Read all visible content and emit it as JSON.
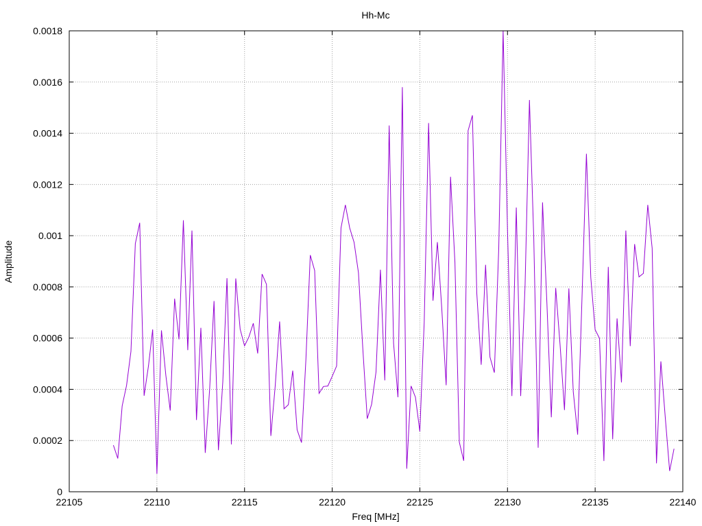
{
  "chart_data": {
    "type": "line",
    "title": "Hh-Mc",
    "xlabel": "Freq [MHz]",
    "ylabel": "Amplitude",
    "xlim": [
      22105,
      22140
    ],
    "ylim": [
      0,
      0.0018
    ],
    "grid": true,
    "x_ticks": [
      22105,
      22110,
      22115,
      22120,
      22125,
      22130,
      22135,
      22140
    ],
    "y_ticks": [
      0,
      0.0002,
      0.0004,
      0.0006,
      0.0008,
      0.001,
      0.0012,
      0.0014,
      0.0016,
      0.0018
    ],
    "x_tick_labels": [
      "22105",
      "22110",
      "22115",
      "22120",
      "22125",
      "22130",
      "22135",
      "22140"
    ],
    "y_tick_labels": [
      "0",
      "0.0002",
      "0.0004",
      "0.0006",
      "0.0008",
      "0.001",
      "0.0012",
      "0.0014",
      "0.0016",
      "0.0018"
    ],
    "series": [
      {
        "color": "#9400d3",
        "x": [
          22107.52,
          22107.77,
          22108.02,
          22108.27,
          22108.52,
          22108.77,
          22109.02,
          22109.27,
          22109.52,
          22109.76,
          22110.0,
          22110.26,
          22110.51,
          22110.76,
          22111.01,
          22111.26,
          22111.51,
          22111.76,
          22112.0,
          22112.26,
          22112.51,
          22112.76,
          22113.01,
          22113.26,
          22113.51,
          22113.76,
          22114.0,
          22114.25,
          22114.5,
          22114.75,
          22115.0,
          22115.25,
          22115.5,
          22115.75,
          22116.0,
          22116.25,
          22116.5,
          22116.75,
          22117.0,
          22117.25,
          22117.5,
          22117.75,
          22118.0,
          22118.25,
          22118.5,
          22118.75,
          22119.0,
          22119.25,
          22119.5,
          22119.75,
          22120.0,
          22120.25,
          22120.5,
          22120.75,
          22121.0,
          22121.25,
          22121.5,
          22121.75,
          22122.0,
          22122.25,
          22122.5,
          22122.75,
          22123.0,
          22123.25,
          22123.5,
          22123.75,
          22124.0,
          22124.25,
          22124.5,
          22124.75,
          22125.0,
          22125.25,
          22125.5,
          22125.75,
          22126.0,
          22126.25,
          22126.5,
          22126.75,
          22127.0,
          22127.25,
          22127.5,
          22127.75,
          22128.0,
          22128.25,
          22128.5,
          22128.75,
          22129.0,
          22129.25,
          22129.5,
          22129.75,
          22130.0,
          22130.25,
          22130.5,
          22130.75,
          22131.0,
          22131.25,
          22131.5,
          22131.75,
          22132.0,
          22132.25,
          22132.5,
          22132.75,
          22133.0,
          22133.25,
          22133.5,
          22133.75,
          22134.0,
          22134.25,
          22134.5,
          22134.75,
          22135.0,
          22135.25,
          22135.5,
          22135.75,
          22136.0,
          22136.25,
          22136.5,
          22136.75,
          22137.0,
          22137.25,
          22137.5,
          22137.75,
          22138.0,
          22138.25,
          22138.5,
          22138.75,
          22139.0,
          22139.25,
          22139.5
        ],
        "values": [
          0.000182,
          0.00013,
          0.000335,
          0.000415,
          0.000548,
          0.000969,
          0.00105,
          0.000375,
          0.000492,
          0.000634,
          7e-05,
          0.00063,
          0.000455,
          0.000317,
          0.000754,
          0.000595,
          0.00106,
          0.000553,
          0.00102,
          0.00028,
          0.00064,
          0.000152,
          0.0004,
          0.000745,
          0.000162,
          0.000429,
          0.000834,
          0.000185,
          0.000833,
          0.000635,
          0.00057,
          0.000605,
          0.000658,
          0.00054,
          0.00085,
          0.00081,
          0.000218,
          0.000415,
          0.000665,
          0.000324,
          0.00034,
          0.000473,
          0.000242,
          0.000192,
          0.000515,
          0.000924,
          0.000864,
          0.000384,
          0.000411,
          0.000413,
          0.000451,
          0.000491,
          0.00103,
          0.00112,
          0.00103,
          0.000974,
          0.000855,
          0.000556,
          0.000285,
          0.000342,
          0.000468,
          0.000867,
          0.000435,
          0.00143,
          0.00058,
          0.000369,
          0.00158,
          9e-05,
          0.000413,
          0.000369,
          0.000236,
          0.000663,
          0.00144,
          0.000746,
          0.000975,
          0.000716,
          0.000416,
          0.00123,
          0.000896,
          0.000194,
          0.000121,
          0.00141,
          0.00147,
          0.000775,
          0.000496,
          0.000886,
          0.000526,
          0.000465,
          0.00095,
          0.0018,
          0.00102,
          0.000374,
          0.00111,
          0.000374,
          0.000805,
          0.00153,
          0.00099,
          0.000172,
          0.00113,
          0.000734,
          0.000291,
          0.000796,
          0.000573,
          0.000319,
          0.000794,
          0.000391,
          0.000223,
          0.000761,
          0.00132,
          0.000836,
          0.000633,
          0.000599,
          0.00012,
          0.000878,
          0.000205,
          0.000677,
          0.000427,
          0.00102,
          0.000569,
          0.000967,
          0.000839,
          0.000853,
          0.00112,
          0.000951,
          0.000111,
          0.000509,
          0.000291,
          8.1e-05,
          0.000168
        ]
      }
    ]
  }
}
